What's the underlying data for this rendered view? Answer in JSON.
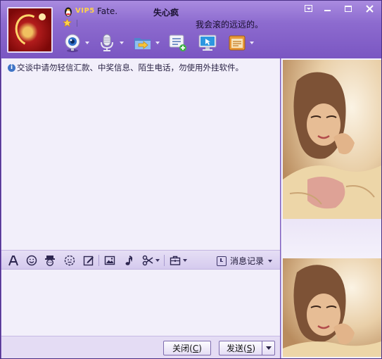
{
  "header": {
    "vip_label": "VIP5",
    "nickname": "Fate.",
    "buddy_name": "失心疯",
    "signature": "我会滚的远远的。"
  },
  "notice": {
    "info_symbol": "i",
    "text": "交谈中请勿轻信汇款、中奖信息、陌生电话，勿使用外挂软件。"
  },
  "format_toolbar": {
    "message_history_label": "消息记录"
  },
  "bottom_bar": {
    "close_label": "关闭",
    "close_hotkey": "C",
    "send_label": "发送",
    "send_hotkey": "S"
  },
  "colors": {
    "title_bar": "#8d6bcf",
    "chat_background": "#f2effa",
    "toolbar_background": "#e4dcf4"
  }
}
